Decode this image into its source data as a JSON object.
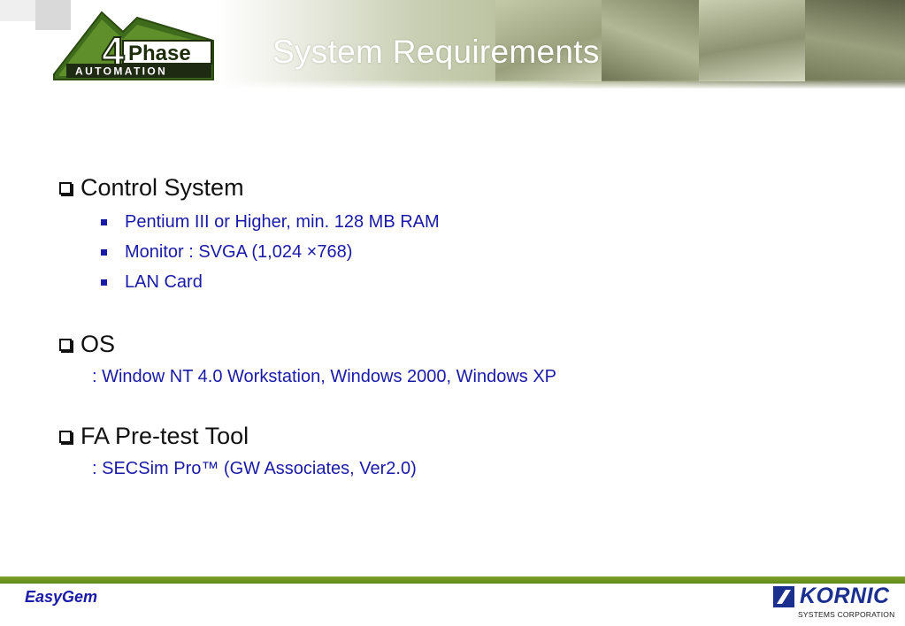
{
  "header": {
    "title": "System Requirements",
    "logo": {
      "number": "4",
      "word": "Phase",
      "tagline": "AUTOMATION"
    }
  },
  "sections": [
    {
      "heading": "Control System",
      "bullets": [
        "Pentium III or Higher,  min. 128 MB RAM",
        "Monitor : SVGA (1,024 ×768)",
        "LAN Card"
      ]
    },
    {
      "heading": "OS",
      "detail": ": Window NT 4.0 Workstation, Windows 2000, Windows XP"
    },
    {
      "heading": "FA Pre-test Tool",
      "detail": ": SECSim Pro™ (GW Associates, Ver2.0)"
    }
  ],
  "footer": {
    "product": "EasyGem",
    "company": {
      "name": "KORNIC",
      "subtitle": "SYSTEMS CORPORATION"
    }
  },
  "colors": {
    "text_blue": "#1a1aa8",
    "footer_green": "#6a951f",
    "kornic_blue": "#1b2f8f"
  }
}
